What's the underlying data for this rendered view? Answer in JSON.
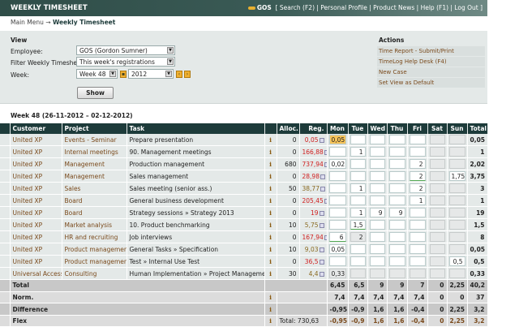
{
  "header": {
    "title": "WEEKLY TIMESHEET",
    "user": "GOS",
    "links": "[ Search (F2) | Personal Profile | Product News | Help (F1) | Log Out ]"
  },
  "breadcrumb": {
    "root": "Main Menu",
    "arrow": "→",
    "current": "Weekly Timesheet"
  },
  "view": {
    "heading": "View",
    "employee_label": "Employee:",
    "employee_value": "GOS (Gordon Sumner)",
    "filter_label": "Filter Weekly Timesheet:",
    "filter_value": "This week's registrations",
    "week_label": "Week:",
    "week_value": "Week 48",
    "year_value": "2012",
    "show_label": "Show"
  },
  "actions": {
    "heading": "Actions",
    "items": [
      "Time Report - Submit/Print",
      "TimeLog Help Desk (F4)",
      "New Case",
      "Set View as Default"
    ]
  },
  "week_title": "Week 48 (26-11-2012 – 02-12-2012)",
  "columns": [
    "Customer",
    "Project",
    "Task",
    "",
    "Alloc.",
    "Reg.",
    "Mon",
    "Tue",
    "Wed",
    "Thu",
    "Fri",
    "Sat",
    "Sun",
    "Total"
  ],
  "rows": [
    {
      "customer": "United XP",
      "project": "Events - Seminar",
      "task": "Prepare presentation",
      "alloc": "0",
      "reg": "0,05",
      "over": true,
      "days": [
        "0,05",
        "",
        "",
        "",
        "",
        "",
        ""
      ],
      "total": "0,05"
    },
    {
      "customer": "United XP",
      "project": "Internal meetings",
      "task": "90. Management meetings",
      "alloc": "0",
      "reg": "166,88",
      "over": true,
      "days": [
        "",
        "1",
        "",
        "",
        "",
        "",
        ""
      ],
      "total": "1"
    },
    {
      "customer": "United XP",
      "project": "Management",
      "task": "Production management",
      "alloc": "680",
      "reg": "737,94",
      "over": true,
      "days": [
        "0,02",
        "",
        "",
        "",
        "2",
        "",
        ""
      ],
      "total": "2,02"
    },
    {
      "customer": "United XP",
      "project": "Management",
      "task": "Sales management",
      "alloc": "0",
      "reg": "28,98",
      "over": true,
      "days": [
        "",
        "",
        "",
        "",
        "2",
        "",
        "1,75"
      ],
      "total": "3,75"
    },
    {
      "customer": "United XP",
      "project": "Sales",
      "task": "Sales meeting (senior ass.)",
      "alloc": "50",
      "reg": "38,77",
      "over": false,
      "days": [
        "",
        "1",
        "",
        "",
        "2",
        "",
        ""
      ],
      "total": "3"
    },
    {
      "customer": "United XP",
      "project": "Board",
      "task": "General business development",
      "alloc": "0",
      "reg": "205,45",
      "over": true,
      "days": [
        "",
        "",
        "",
        "",
        "1",
        "",
        ""
      ],
      "total": "1"
    },
    {
      "customer": "United XP",
      "project": "Board",
      "task": "Strategy sessions » Strategy 2013",
      "alloc": "0",
      "reg": "19",
      "over": true,
      "days": [
        "",
        "1",
        "9",
        "9",
        "",
        "",
        ""
      ],
      "total": "19"
    },
    {
      "customer": "United XP",
      "project": "Market analysis",
      "task": "10. Product benchmarking",
      "alloc": "10",
      "reg": "5,75",
      "over": false,
      "days": [
        "",
        "1,5",
        "",
        "",
        "",
        "",
        ""
      ],
      "total": "1,5"
    },
    {
      "customer": "United XP",
      "project": "HR and recruiting",
      "task": "Job interviews",
      "alloc": "0",
      "reg": "167,94",
      "over": true,
      "days": [
        "6",
        "2",
        "",
        "",
        "",
        "",
        ""
      ],
      "total": "8"
    },
    {
      "customer": "United XP",
      "project": "Product management",
      "task": "General Tasks » Specification",
      "alloc": "10",
      "reg": "9,03",
      "over": false,
      "days": [
        "0,05",
        "",
        "",
        "",
        "",
        "",
        ""
      ],
      "total": "0,05"
    },
    {
      "customer": "United XP",
      "project": "Product management",
      "task": "Test » Internal Use Test",
      "alloc": "0",
      "reg": "36,5",
      "over": true,
      "days": [
        "",
        "",
        "",
        "",
        "",
        "",
        "0,5"
      ],
      "total": "0,5"
    },
    {
      "customer": "Universal Access",
      "project": "Consulting",
      "task": "Human Implementation » Project Management",
      "alloc": "30",
      "reg": "4,4",
      "over": false,
      "days": [
        "0,33",
        "",
        "",
        "",
        "",
        "",
        ""
      ],
      "total": "0,33"
    }
  ],
  "summary": [
    {
      "label": "Total",
      "info": false,
      "note": "",
      "values": [
        "6,45",
        "6,5",
        "9",
        "9",
        "7",
        "0",
        "2,25",
        "40,2"
      ]
    },
    {
      "label": "Norm.",
      "info": true,
      "note": "",
      "values": [
        "7,4",
        "7,4",
        "7,4",
        "7,4",
        "7,4",
        "0",
        "0",
        "37"
      ]
    },
    {
      "label": "Difference",
      "info": true,
      "note": "",
      "values": [
        "-0,95",
        "-0,9",
        "1,6",
        "1,6",
        "-0,4",
        "0",
        "2,25",
        "3,2"
      ]
    },
    {
      "label": "Flex",
      "info": true,
      "note": "Total: 730,63",
      "values": [
        "-0,95",
        "-0,9",
        "1,6",
        "1,6",
        "-0,4",
        "0",
        "2,25",
        "3,2"
      ]
    }
  ]
}
